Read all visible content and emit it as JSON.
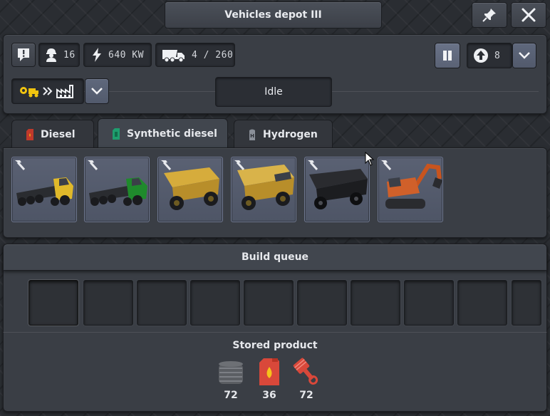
{
  "window": {
    "title": "Vehicles depot III",
    "pin_icon": "pin-icon",
    "close_icon": "close-icon"
  },
  "status_bar": {
    "workers": "16",
    "power": "640 KW",
    "vehicles": "4 / 260",
    "priority": "8"
  },
  "recipe": {
    "state": "Idle"
  },
  "tabs": [
    {
      "label": "Diesel",
      "icon": "diesel-canister-icon",
      "color": "#c0392b",
      "active": false
    },
    {
      "label": "Synthetic diesel",
      "icon": "synthetic-diesel-canister-icon",
      "color": "#1e9e6e",
      "active": true
    },
    {
      "label": "Hydrogen",
      "icon": "hydrogen-canister-icon",
      "color": "#8a8f98",
      "active": false
    }
  ],
  "vehicles": [
    {
      "name": "yellow-truck"
    },
    {
      "name": "green-truck"
    },
    {
      "name": "yellow-haul-truck"
    },
    {
      "name": "large-yellow-haul-truck"
    },
    {
      "name": "black-haul-truck"
    },
    {
      "name": "orange-excavator"
    }
  ],
  "queue": {
    "title": "Build queue",
    "slots": 10
  },
  "stored": {
    "title": "Stored product",
    "items": [
      {
        "icon": "rubber-roll-icon",
        "count": "72"
      },
      {
        "icon": "fuel-canister-icon",
        "count": "36"
      },
      {
        "icon": "piston-icon",
        "count": "72"
      }
    ]
  }
}
